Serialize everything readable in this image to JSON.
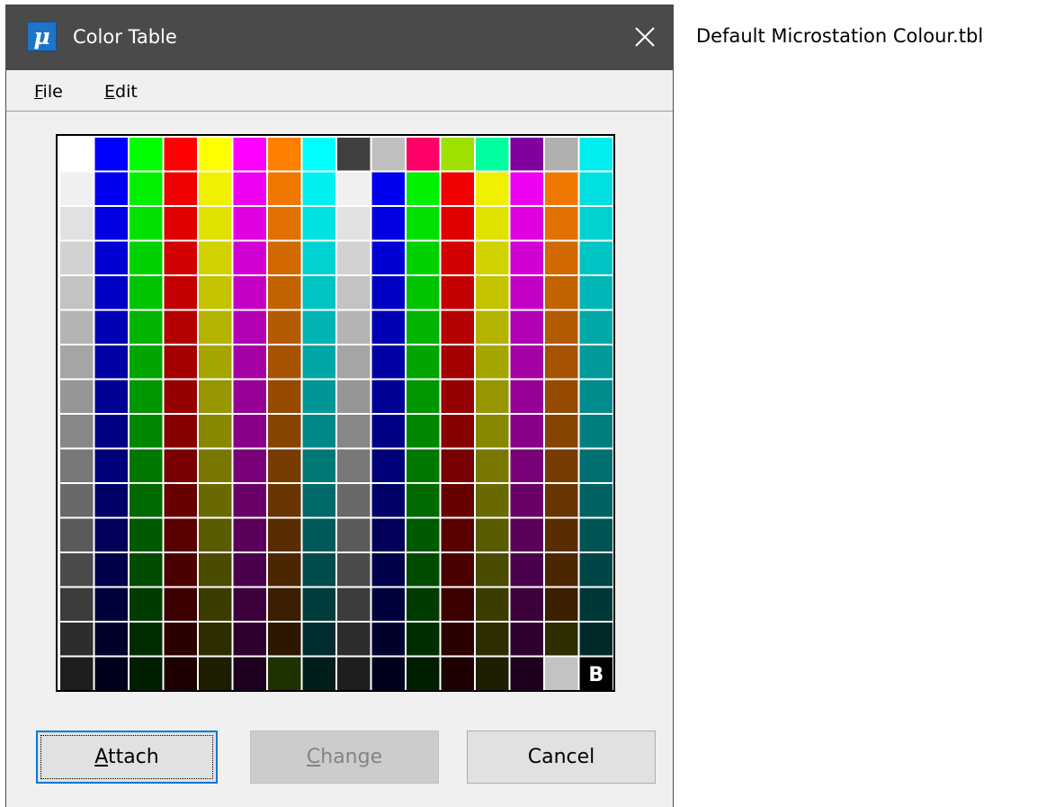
{
  "window": {
    "title": "Color Table",
    "icon": "microstation-mu-icon",
    "icon_glyph": "μ"
  },
  "menu": [
    {
      "mnemonic": "F",
      "rest": "ile"
    },
    {
      "mnemonic": "E",
      "rest": "dit"
    }
  ],
  "color_table": {
    "rows": 16,
    "columns": 16,
    "background_marker": "B",
    "palette": [
      [
        "#ffffff",
        "#0000ff",
        "#00ff00",
        "#ff0000",
        "#ffff00",
        "#ff00ff",
        "#ff7f00",
        "#00ffff",
        "#404040",
        "#c0c0c0",
        "#ff0066",
        "#a0e000",
        "#00ff9f",
        "#8000a0",
        "#b0b0b0",
        "#00eef0"
      ],
      [
        "#f0f0f0",
        "#0000f0",
        "#00f000",
        "#f00000",
        "#f0f000",
        "#f000f0",
        "#f07800",
        "#00f0f0",
        "#f0f0f0",
        "#0000f0",
        "#00f000",
        "#f00000",
        "#f0f000",
        "#f000f0",
        "#f07800",
        "#00e0e0"
      ],
      [
        "#e1e1e1",
        "#0000e1",
        "#00e100",
        "#e10000",
        "#e1e100",
        "#e100e1",
        "#e17100",
        "#00e1e1",
        "#e1e1e1",
        "#0000e1",
        "#00e100",
        "#e10000",
        "#e1e100",
        "#e100e1",
        "#e17100",
        "#00d2d2"
      ],
      [
        "#d2d2d2",
        "#0000d2",
        "#00d200",
        "#d20000",
        "#d2d200",
        "#d200d2",
        "#d26900",
        "#00d2d2",
        "#d2d2d2",
        "#0000d2",
        "#00d200",
        "#d20000",
        "#d2d200",
        "#d200d2",
        "#d26900",
        "#00c4c4"
      ],
      [
        "#c3c3c3",
        "#0000c3",
        "#00c300",
        "#c30000",
        "#c3c300",
        "#c300c3",
        "#c36200",
        "#00c3c3",
        "#c3c3c3",
        "#0000c3",
        "#00c300",
        "#c30000",
        "#c3c300",
        "#c300c3",
        "#c36200",
        "#00b6b6"
      ],
      [
        "#b4b4b4",
        "#0000b4",
        "#00b400",
        "#b40000",
        "#b4b400",
        "#b400b4",
        "#b45a00",
        "#00b4b4",
        "#b4b4b4",
        "#0000b4",
        "#00b400",
        "#b40000",
        "#b4b400",
        "#b400b4",
        "#b45a00",
        "#00a8a8"
      ],
      [
        "#a5a5a5",
        "#0000a5",
        "#00a500",
        "#a50000",
        "#a5a500",
        "#a500a5",
        "#a55300",
        "#00a5a5",
        "#a5a5a5",
        "#0000a5",
        "#00a500",
        "#a50000",
        "#a5a500",
        "#a500a5",
        "#a55300",
        "#009a9a"
      ],
      [
        "#969696",
        "#000096",
        "#009600",
        "#960000",
        "#969600",
        "#960096",
        "#964b00",
        "#009696",
        "#969696",
        "#000096",
        "#009600",
        "#960000",
        "#969600",
        "#960096",
        "#964b00",
        "#008c8c"
      ],
      [
        "#878787",
        "#000087",
        "#008700",
        "#870000",
        "#878700",
        "#870087",
        "#874400",
        "#008787",
        "#878787",
        "#000087",
        "#008700",
        "#870000",
        "#878700",
        "#870087",
        "#874400",
        "#007e7e"
      ],
      [
        "#787878",
        "#000078",
        "#007800",
        "#780000",
        "#787800",
        "#780078",
        "#783c00",
        "#007878",
        "#787878",
        "#000078",
        "#007800",
        "#780000",
        "#787800",
        "#780078",
        "#783c00",
        "#007070"
      ],
      [
        "#696969",
        "#000069",
        "#006900",
        "#690000",
        "#696900",
        "#690069",
        "#693500",
        "#006969",
        "#696969",
        "#000069",
        "#006900",
        "#690000",
        "#696900",
        "#690069",
        "#693500",
        "#006262"
      ],
      [
        "#5a5a5a",
        "#00005a",
        "#005a00",
        "#5a0000",
        "#5a5a00",
        "#5a005a",
        "#5a2d00",
        "#005a5a",
        "#5a5a5a",
        "#00005a",
        "#005a00",
        "#5a0000",
        "#5a5a00",
        "#5a005a",
        "#5a2d00",
        "#005454"
      ],
      [
        "#4b4b4b",
        "#00004b",
        "#004b00",
        "#4b0000",
        "#4b4b00",
        "#4b004b",
        "#4b2600",
        "#004b4b",
        "#4b4b4b",
        "#00004b",
        "#004b00",
        "#4b0000",
        "#4b4b00",
        "#4b004b",
        "#4b2600",
        "#004646"
      ],
      [
        "#3c3c3c",
        "#00003c",
        "#003c00",
        "#3c0000",
        "#3c3c00",
        "#3c003c",
        "#3c1e00",
        "#003c3c",
        "#3c3c3c",
        "#00003c",
        "#003c00",
        "#3c0000",
        "#3c3c00",
        "#3c003c",
        "#3c1e00",
        "#003838"
      ],
      [
        "#2d2d2d",
        "#00002d",
        "#002d00",
        "#2d0000",
        "#2d2d00",
        "#2d002d",
        "#2d1700",
        "#002d2d",
        "#2d2d2d",
        "#00002d",
        "#002d00",
        "#2d0000",
        "#2d2d00",
        "#2d002d",
        "#2d2d00",
        "#002a2a"
      ],
      [
        "#1e1e1e",
        "#00001e",
        "#001e00",
        "#1e0000",
        "#1e1e00",
        "#1e001e",
        "#1e3300",
        "#001e1e",
        "#1e1e1e",
        "#00001e",
        "#001e00",
        "#1e0000",
        "#1e1e00",
        "#1e001e",
        "#c3c3c3",
        "#000000"
      ]
    ]
  },
  "buttons": {
    "attach": {
      "mnemonic": "A",
      "rest": "ttach"
    },
    "change": {
      "mnemonic": "C",
      "rest": "hange"
    },
    "cancel": {
      "label": "Cancel"
    }
  },
  "caption": "Default Microstation Colour.tbl"
}
